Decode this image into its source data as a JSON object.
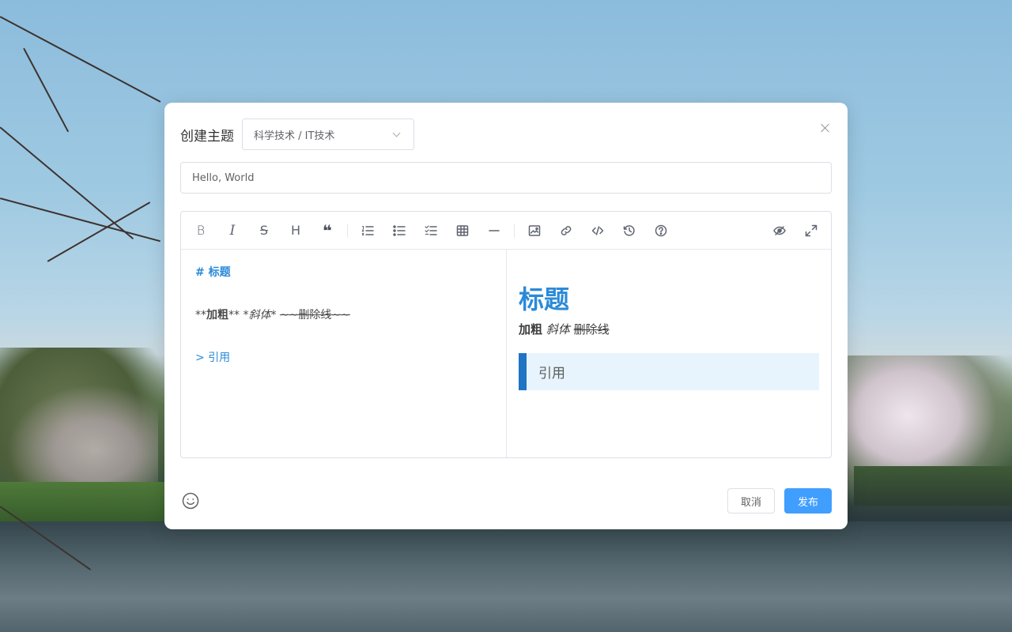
{
  "dialog": {
    "title": "创建主题",
    "category_select": "科学技术 / IT技术",
    "title_input_value": "Hello, World",
    "colors": {
      "accent": "#409eff",
      "heading": "#2b8ad8",
      "quote_bar": "#1f74c4",
      "quote_bg": "#e7f4fd"
    }
  },
  "toolbar": {
    "icons": [
      "bold-icon",
      "italic-icon",
      "strikethrough-icon",
      "heading-icon",
      "quote-icon",
      "ordered-list-icon",
      "unordered-list-icon",
      "task-list-icon",
      "table-icon",
      "horizontal-rule-icon",
      "image-icon",
      "link-icon",
      "code-icon",
      "history-icon",
      "help-icon",
      "preview-toggle-icon",
      "fullscreen-icon"
    ],
    "bold": "B",
    "italic": "I",
    "strike": "S",
    "heading": "H",
    "quote": "❝"
  },
  "source": {
    "line1": "# 标题",
    "line2_pre": "**",
    "line2_bold": "加粗",
    "line2_mid": "** *",
    "line2_italic": "斜体",
    "line2_mid2": "* ",
    "line2_strike": "~~删除线~~",
    "line3": "> 引用"
  },
  "preview": {
    "h1": "标题",
    "bold": "加粗",
    "italic": "斜体",
    "strike": "删除线",
    "quote": "引用"
  },
  "footer": {
    "cancel": "取消",
    "publish": "发布"
  }
}
